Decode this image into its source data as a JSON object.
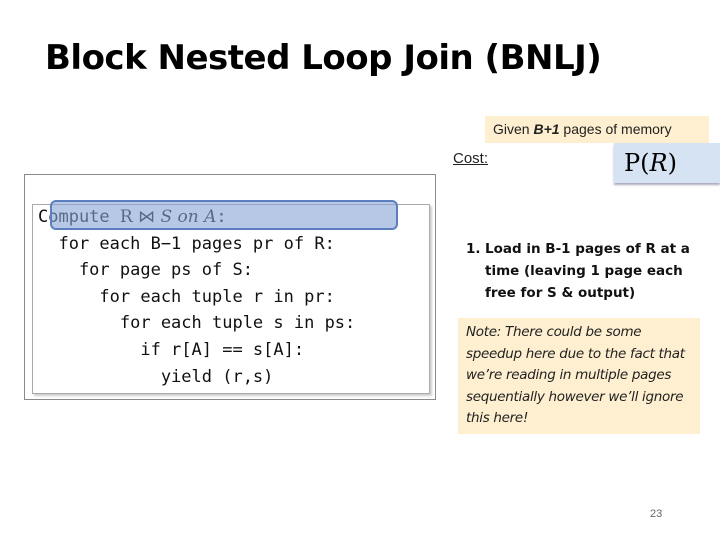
{
  "slide": {
    "title": "Block Nested Loop Join (BNLJ)",
    "given": {
      "prefix": "Given ",
      "emphasis": "B+1",
      "suffix": " pages of memory"
    },
    "cost_label": "Cost:",
    "cost_formula": {
      "fn": "P(",
      "arg": "R",
      "close": ")"
    },
    "code": {
      "line0_prefix": "Compute ",
      "line0_math_r": "R ⋈ ",
      "line0_math_rest": "S on A",
      "line0_suffix": ":",
      "lines": [
        "  for each B−1 pages pr of R:",
        "    for page ps of S:",
        "      for each tuple r in pr:",
        "        for each tuple s in ps:",
        "          if r[A] == s[A]:",
        "            yield (r,s)"
      ]
    },
    "step": {
      "number": "1.",
      "text": "Load in B-1 pages of R at a time (leaving 1 page each free for S & output)"
    },
    "note": "Note: There could be some speedup here due to the fact that we’re reading in multiple pages sequentially however we’ll ignore this here!",
    "page_number": "23"
  }
}
